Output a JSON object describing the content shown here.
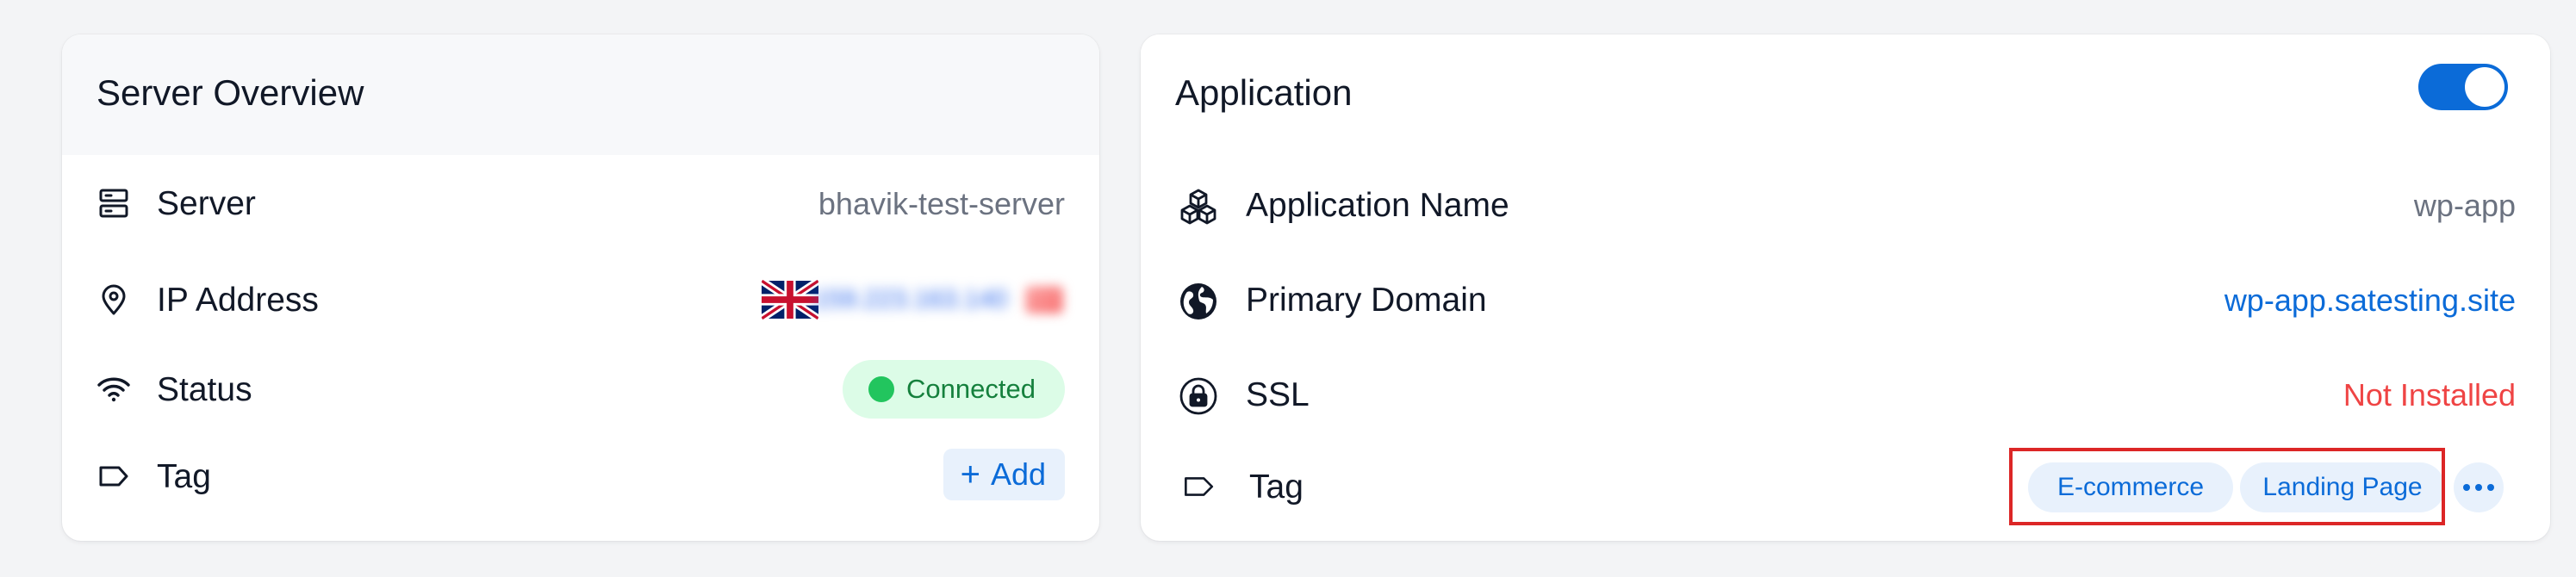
{
  "server_overview": {
    "title": "Server Overview",
    "rows": {
      "server": {
        "label": "Server",
        "value": "bhavik-test-server",
        "icon": "server-icon"
      },
      "ip": {
        "label": "IP Address",
        "value": "159.223.163.140",
        "icon": "map-pin-icon",
        "flag": "united-kingdom-flag-icon"
      },
      "status": {
        "label": "Status",
        "value": "Connected",
        "icon": "wifi-icon",
        "color": "#22c55e"
      },
      "tag": {
        "label": "Tag",
        "button": "Add",
        "icon": "tag-icon"
      }
    }
  },
  "application": {
    "title": "Application",
    "toggle_on": true,
    "rows": {
      "name": {
        "label": "Application Name",
        "value": "wp-app",
        "icon": "cubes-icon"
      },
      "domain": {
        "label": "Primary Domain",
        "value": "wp-app.satesting.site",
        "icon": "globe-icon"
      },
      "ssl": {
        "label": "SSL",
        "value": "Not Installed",
        "icon": "lock-icon",
        "color": "#ef4444"
      },
      "tag": {
        "label": "Tag",
        "icon": "tag-icon",
        "tags": [
          "E-commerce",
          "Landing Page"
        ]
      }
    }
  },
  "colors": {
    "accent": "#0b6bd8",
    "success": "#22c55e",
    "danger": "#ef4444",
    "highlight": "#dc2626"
  }
}
